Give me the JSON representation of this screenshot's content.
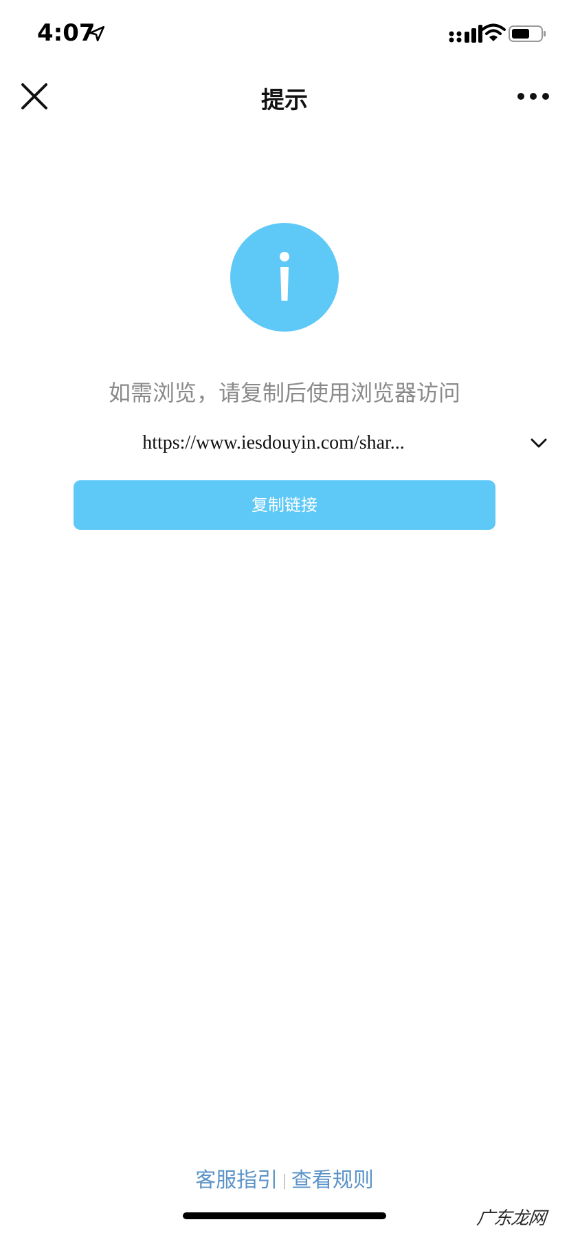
{
  "status_bar": {
    "time": "4:07",
    "icons": [
      "location-arrow-icon",
      "signal-icon",
      "wifi-icon",
      "battery-icon"
    ]
  },
  "nav": {
    "title": "提示",
    "close_icon": "close-icon",
    "more_icon": "more-icon"
  },
  "main": {
    "info_icon": "info-icon",
    "info_color": "#5ec8f7",
    "prompt": "如需浏览，请复制后使用浏览器访问",
    "url": "https://www.iesdouyin.com/shar...",
    "expand_icon": "chevron-down-icon",
    "copy_button_label": "复制链接",
    "accent_color": "#5ec8f7"
  },
  "footer": {
    "link_service": "客服指引",
    "separator": "|",
    "link_rules": "查看规则",
    "link_color": "#5b93c8"
  },
  "watermark": {
    "text": "广东龙网"
  }
}
